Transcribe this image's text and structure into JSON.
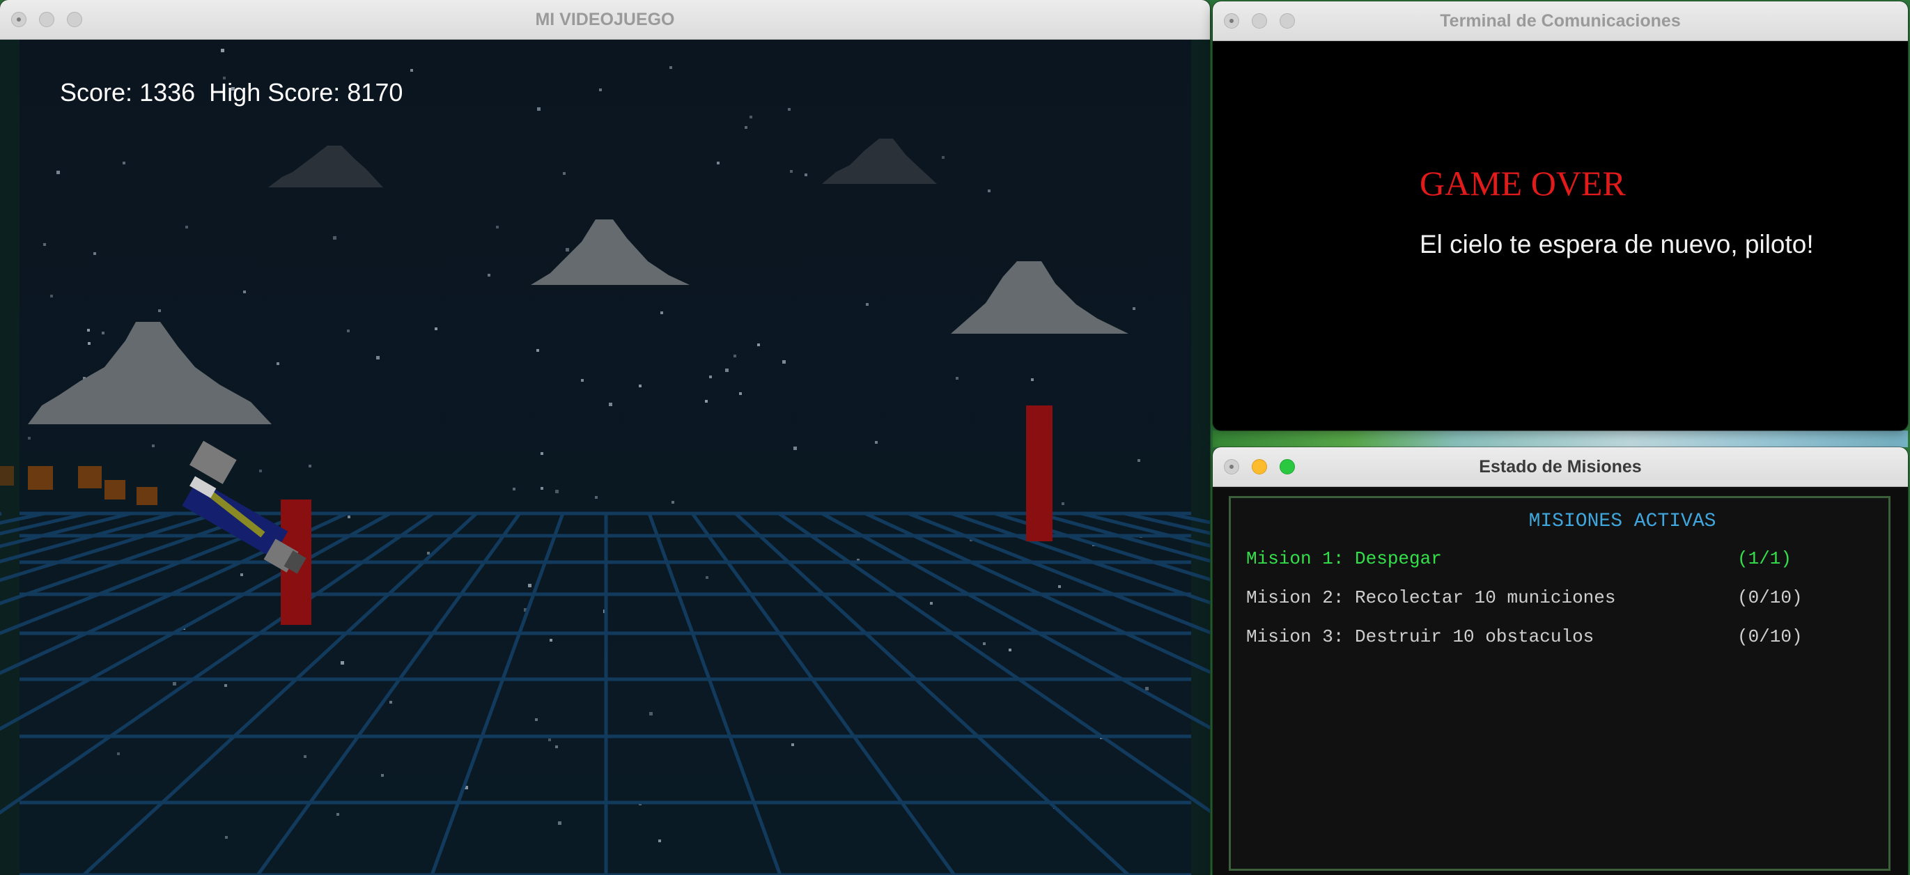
{
  "game_window": {
    "title": "MI VIDEOJUEGO",
    "hud": {
      "score_label": "Score:",
      "score": 1336,
      "high_score_label": "High Score:",
      "high_score": 8170
    }
  },
  "terminal_window": {
    "title": "Terminal de Comunicaciones",
    "game_over_title": "GAME OVER",
    "game_over_message": "El cielo te espera de nuevo, piloto!"
  },
  "missions_window": {
    "title": "Estado de Misiones",
    "heading": "MISIONES ACTIVAS",
    "missions": [
      {
        "label": "Mision 1: Despegar",
        "progress": "(1/1)",
        "completed": true
      },
      {
        "label": "Mision 2: Recolectar 10 municiones",
        "progress": "(0/10)",
        "completed": false
      },
      {
        "label": "Mision 3: Destruir 10 obstaculos",
        "progress": "(0/10)",
        "completed": false
      }
    ]
  },
  "colors": {
    "sky": "#0b1520",
    "grid": "#123a5c",
    "obstacle": "#8a0f10",
    "cloud": "#7a7a7a",
    "game_over": "#e21a1a",
    "mission_done": "#33e04a",
    "mission_heading": "#3fa7dd"
  }
}
